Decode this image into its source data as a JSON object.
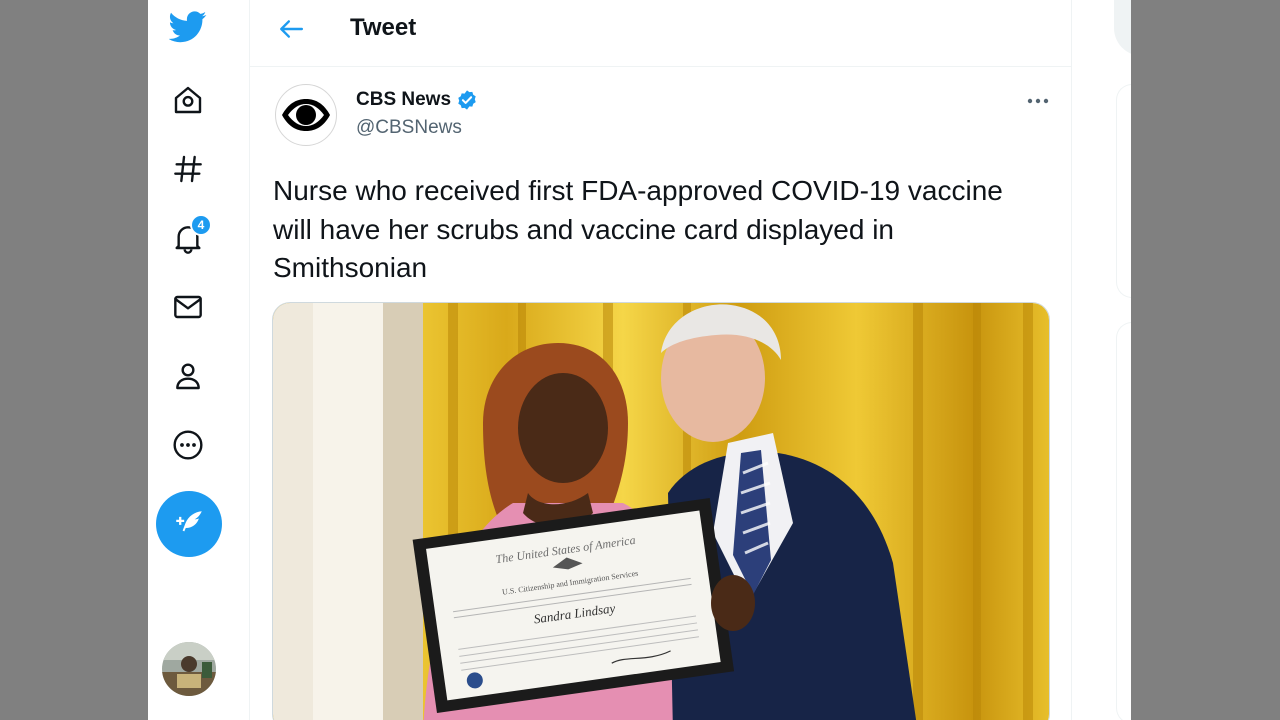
{
  "nav": {
    "items": [
      {
        "name": "twitter-logo-icon"
      },
      {
        "name": "home-icon"
      },
      {
        "name": "explore-hashtag-icon"
      },
      {
        "name": "notifications-bell-icon"
      },
      {
        "name": "messages-envelope-icon"
      },
      {
        "name": "profile-person-icon"
      },
      {
        "name": "more-circle-icon"
      }
    ],
    "notification_badge": "4",
    "compose_icon": "feather-plus-icon"
  },
  "header": {
    "title": "Tweet",
    "back_icon": "arrow-left-icon"
  },
  "tweet": {
    "author_name": "CBS News",
    "author_handle": "@CBSNews",
    "verified": true,
    "text": "Nurse who received first FDA-approved COVID-19 vaccine will have her scrubs and vaccine card displayed in Smithsonian",
    "media": {
      "certificate_heading": "The United States of America",
      "certificate_agency": "U.S. Citizenship and Immigration Services",
      "certificate_name": "Sandra Lindsay"
    }
  },
  "colors": {
    "accent": "#1d9bf0",
    "text_primary": "#0f1419",
    "text_secondary": "#536471",
    "backdrop": "#808080"
  }
}
